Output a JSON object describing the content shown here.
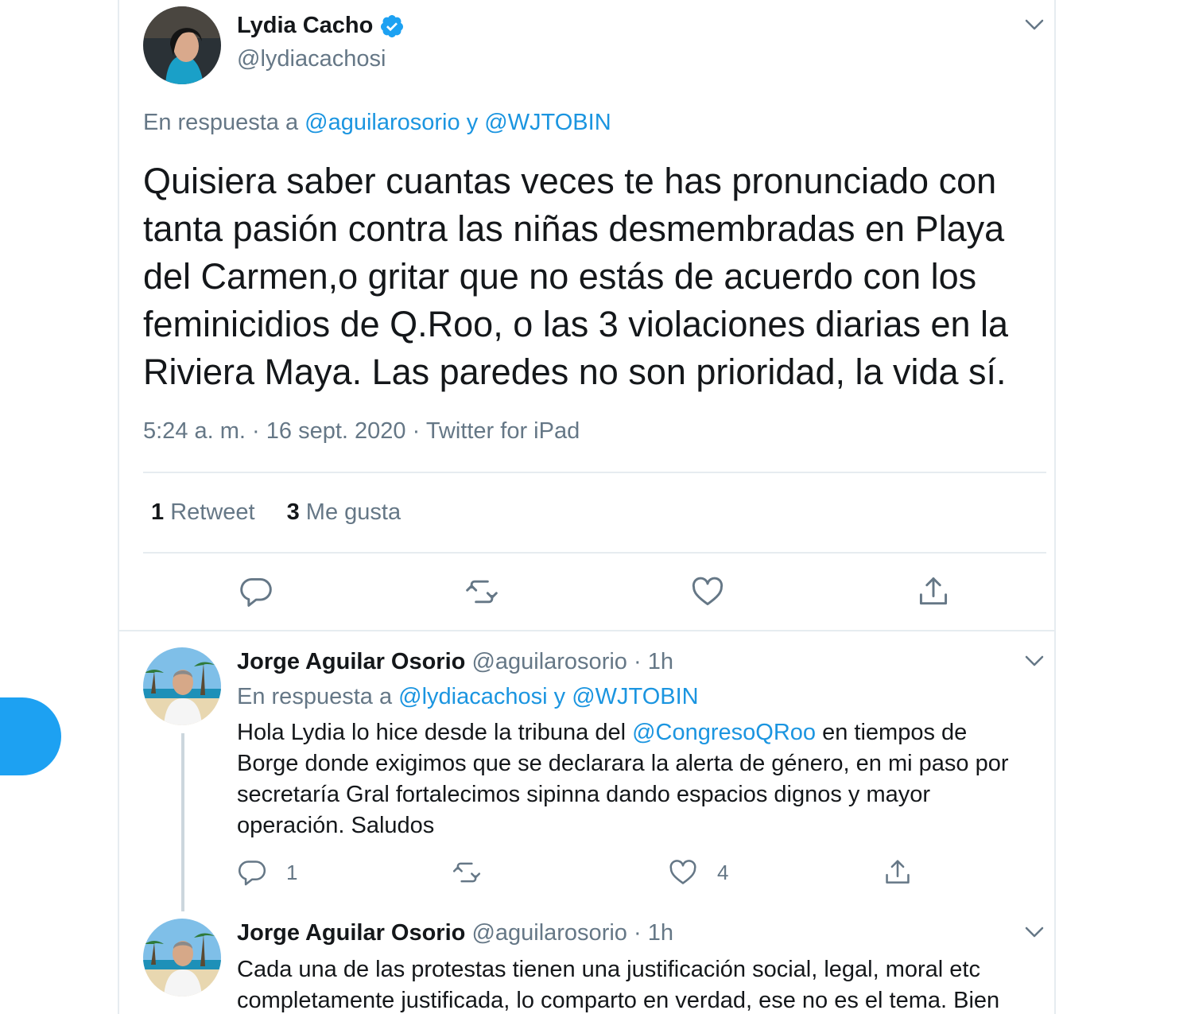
{
  "main_tweet": {
    "author_name": "Lydia Cacho",
    "author_handle": "@lydiacachosi",
    "reply_prefix": "En respuesta a",
    "reply_user1": "@aguilarosorio",
    "reply_and": "y",
    "reply_user2": "@WJTOBIN",
    "text_lines": [
      "Quisiera saber cuantas veces te has pronunciado con",
      "tanta pasión contra las niñas desmembradas en Playa",
      "del Carmen,o gritar que no estás de acuerdo con los",
      "feminicidios de Q.Roo, o las 3 violaciones diarias en la",
      "Riviera Maya. Las paredes no son prioridad, la vida sí."
    ],
    "time": "5:24 a. m.",
    "date": "16 sept. 2020",
    "source": "Twitter for iPad",
    "sep": "·",
    "retweet_count": "1",
    "retweet_label": "Retweet",
    "like_count": "3",
    "like_label": "Me gusta"
  },
  "replies": [
    {
      "author_name": "Jorge Aguilar Osorio",
      "author_handle": "@aguilarosorio",
      "sep": "·",
      "time": "1h",
      "reply_prefix": "En respuesta a",
      "reply_user1": "@lydiacachosi",
      "reply_and": "y",
      "reply_user2": "@WJTOBIN",
      "text_line1_pre": "Hola Lydia lo hice desde la tribuna del",
      "text_line1_mention": "@CongresoQRoo",
      "text_line1_post": "en tiempos de",
      "text_line2": "Borge donde exigimos que se declarara la alerta de género, en mi paso por",
      "text_line3": "secretaría Gral fortalecimos sipinna dando espacios dignos y mayor",
      "text_line4": "operación. Saludos",
      "reply_count": "1",
      "retweet_count": "",
      "like_count": "4"
    },
    {
      "author_name": "Jorge Aguilar Osorio",
      "author_handle": "@aguilarosorio",
      "sep": "·",
      "time": "1h",
      "text_line1": "Cada una de las protestas tienen una justificación social, legal, moral etc",
      "text_line2": "completamente justificada, lo comparto en verdad, ese no es el tema. Bien"
    }
  ],
  "colors": {
    "accent": "#1da1f2",
    "link": "#1b95e0",
    "muted": "#657786",
    "text": "#14171a",
    "border": "#e6ecf0"
  },
  "icons": {
    "verified": "verified-badge-icon",
    "caret": "chevron-down-icon",
    "reply": "reply-icon",
    "retweet": "retweet-icon",
    "like": "heart-icon",
    "share": "share-icon"
  }
}
